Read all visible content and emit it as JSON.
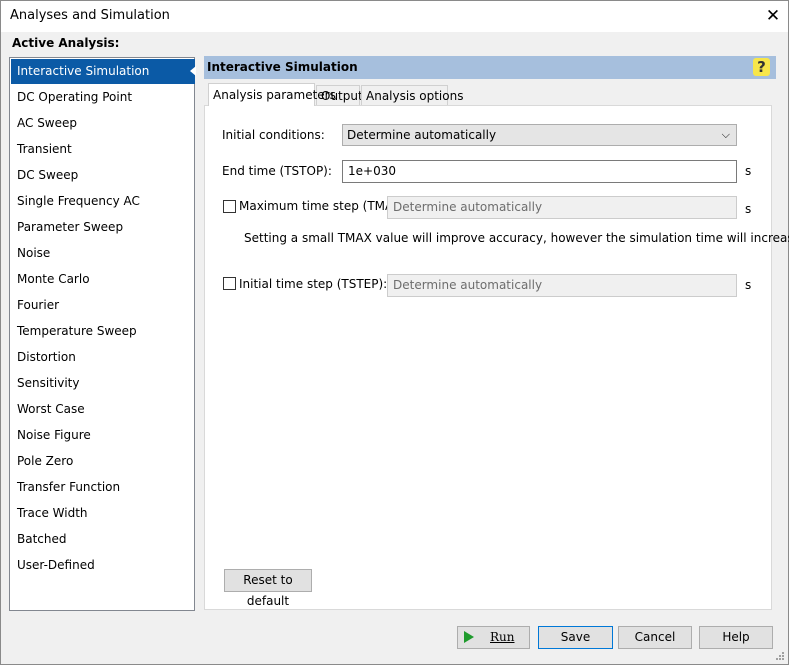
{
  "window": {
    "title": "Analyses and Simulation"
  },
  "active_analysis_label": "Active Analysis:",
  "analyses": [
    "Interactive Simulation",
    "DC Operating Point",
    "AC Sweep",
    "Transient",
    "DC Sweep",
    "Single Frequency AC",
    "Parameter Sweep",
    "Noise",
    "Monte Carlo",
    "Fourier",
    "Temperature Sweep",
    "Distortion",
    "Sensitivity",
    "Worst Case",
    "Noise Figure",
    "Pole Zero",
    "Transfer Function",
    "Trace Width",
    "Batched",
    "User-Defined"
  ],
  "selected_analysis": "Interactive Simulation",
  "header": {
    "title": "Interactive Simulation",
    "help_icon": "?"
  },
  "tabs": [
    "Analysis parameters",
    "Output",
    "Analysis options"
  ],
  "active_tab": "Analysis parameters",
  "params": {
    "initial_conditions": {
      "label": "Initial conditions:",
      "value": "Determine automatically"
    },
    "end_time": {
      "label": "End time (TSTOP):",
      "value": "1e+030",
      "unit": "s"
    },
    "max_step": {
      "label": "Maximum time step (TMAX):",
      "value": "Determine automatically",
      "unit": "s",
      "checked": false
    },
    "tmax_note": "Setting a small TMAX value will improve accuracy, however the simulation time will increase.",
    "initial_step": {
      "label": "Initial time step (TSTEP):",
      "value": "Determine automatically",
      "unit": "s",
      "checked": false
    }
  },
  "reset_button": "Reset to default",
  "buttons": {
    "run": "Run",
    "save": "Save",
    "cancel": "Cancel",
    "help": "Help"
  },
  "colors": {
    "selection": "#0b5aa6",
    "header": "#a6bfdd",
    "run_icon": "#1e9a2c"
  }
}
